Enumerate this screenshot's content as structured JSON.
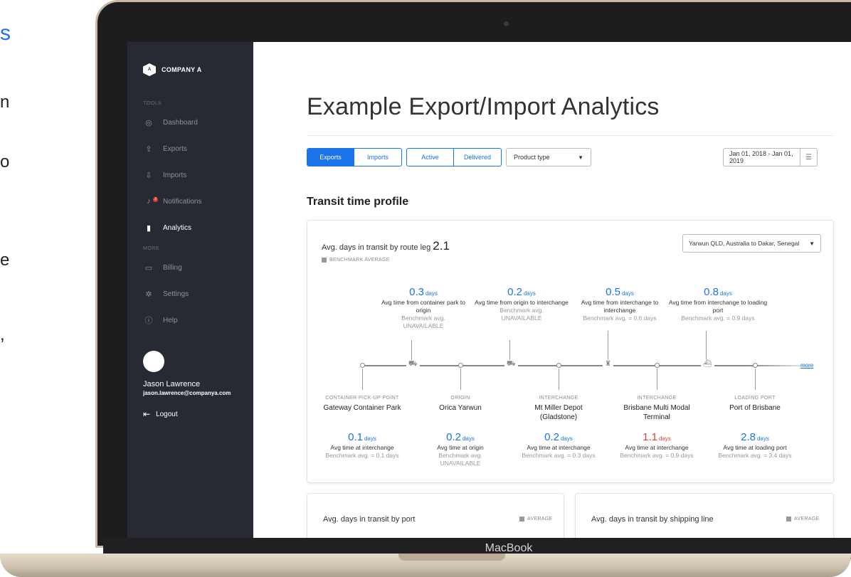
{
  "side_text": {
    "accent": "s",
    "lines": [
      "n",
      "o",
      "e",
      ","
    ]
  },
  "laptop": {
    "brand": "MacBook"
  },
  "sidebar": {
    "company_logo_letter": "A",
    "company_name": "COMPANY A",
    "tools_label": "TOOLS",
    "more_label": "MORE",
    "items": [
      {
        "label": "Dashboard",
        "icon": "dashboard-icon"
      },
      {
        "label": "Exports",
        "icon": "export-icon"
      },
      {
        "label": "Imports",
        "icon": "import-icon"
      },
      {
        "label": "Notifications",
        "icon": "bell-icon",
        "badge": "2"
      },
      {
        "label": "Analytics",
        "icon": "bar-chart-icon",
        "active": true
      },
      {
        "label": "Billing",
        "icon": "card-icon"
      },
      {
        "label": "Settings",
        "icon": "gear-icon"
      },
      {
        "label": "Help",
        "icon": "help-icon"
      }
    ],
    "user": {
      "name": "Jason Lawrence",
      "email": "jason.lawrence@companya.com"
    },
    "logout_label": "Logout"
  },
  "main": {
    "title": "Example Export/Import Analytics",
    "filters": {
      "direction": [
        "Exports",
        "Imports"
      ],
      "status": [
        "Active",
        "Delivered"
      ],
      "product_type": "Product type",
      "date_range": "Jan 01, 2018 - Jan 01, 2019"
    },
    "section_title": "Transit time profile",
    "route_card": {
      "title": "Avg. days in transit by route leg",
      "total": "2.1",
      "benchmark_label": "BENCHMARK AVERAGE",
      "route": "Yarwun QLD, Australia to Dakar, Senegal",
      "more_label": "more",
      "legs": [
        {
          "value": "0.3",
          "unit": "days",
          "desc": "Avg time from container park to origin",
          "bench": "Benchmark avg.",
          "bench2": "UNAVAILABLE"
        },
        {
          "value": "0.2",
          "unit": "days",
          "desc": "Avg time from origin to interchange",
          "bench": "Benchmark avg.",
          "bench2": "UNAVAILABLE"
        },
        {
          "value": "0.5",
          "unit": "days",
          "desc": "Avg time from interchange to interchange",
          "bench": "Benchmark avg. = 0.6 days"
        },
        {
          "value": "0.8",
          "unit": "days",
          "desc": "Avg time from interchange to loading port",
          "bench": "Benchmark avg. = 0.9 days"
        }
      ],
      "stops": [
        {
          "type": "CONTAINER PICK-UP POINT",
          "name": "Gateway Container Park",
          "value": "0.1",
          "unit": "days",
          "desc": "Avg time at interchange",
          "bench": "Benchmark avg. = 0.1 days"
        },
        {
          "type": "ORIGIN",
          "name": "Orica Yarwun",
          "value": "0.2",
          "unit": "days",
          "desc": "Avg time at origin",
          "bench": "Benchmark avg.",
          "bench2": "UNAVAILABLE"
        },
        {
          "type": "INTERCHANGE",
          "name": "Mt Miller Depot (Gladstone)",
          "value": "0.2",
          "unit": "days",
          "desc": "Avg time at interchange",
          "bench": "Benchmark avg. = 0.3 days"
        },
        {
          "type": "INTERCHANGE",
          "name": "Brisbane Multi Modal Terminal",
          "value": "1.1",
          "unit": "days",
          "desc": "Avg time at interchange",
          "bench": "Benchmark avg. = 0.9 days",
          "alert": true
        },
        {
          "type": "LOADING PORT",
          "name": "Port of Brisbane",
          "value": "2.8",
          "unit": "days",
          "desc": "Avg time at loading port",
          "bench": "Benchmark avg. = 3.4 days"
        }
      ],
      "transport_icons": [
        "truck-icon",
        "truck-icon",
        "train-icon",
        "ship-icon"
      ]
    },
    "port_card": {
      "title": "Avg. days in transit by port",
      "legend": "AVERAGE"
    },
    "shipping_card": {
      "title": "Avg. days in transit by shipping line",
      "legend": "AVERAGE"
    }
  },
  "colors": {
    "accent": "#1a73e8",
    "sidebar": "#262a33",
    "alert": "#e53935"
  }
}
